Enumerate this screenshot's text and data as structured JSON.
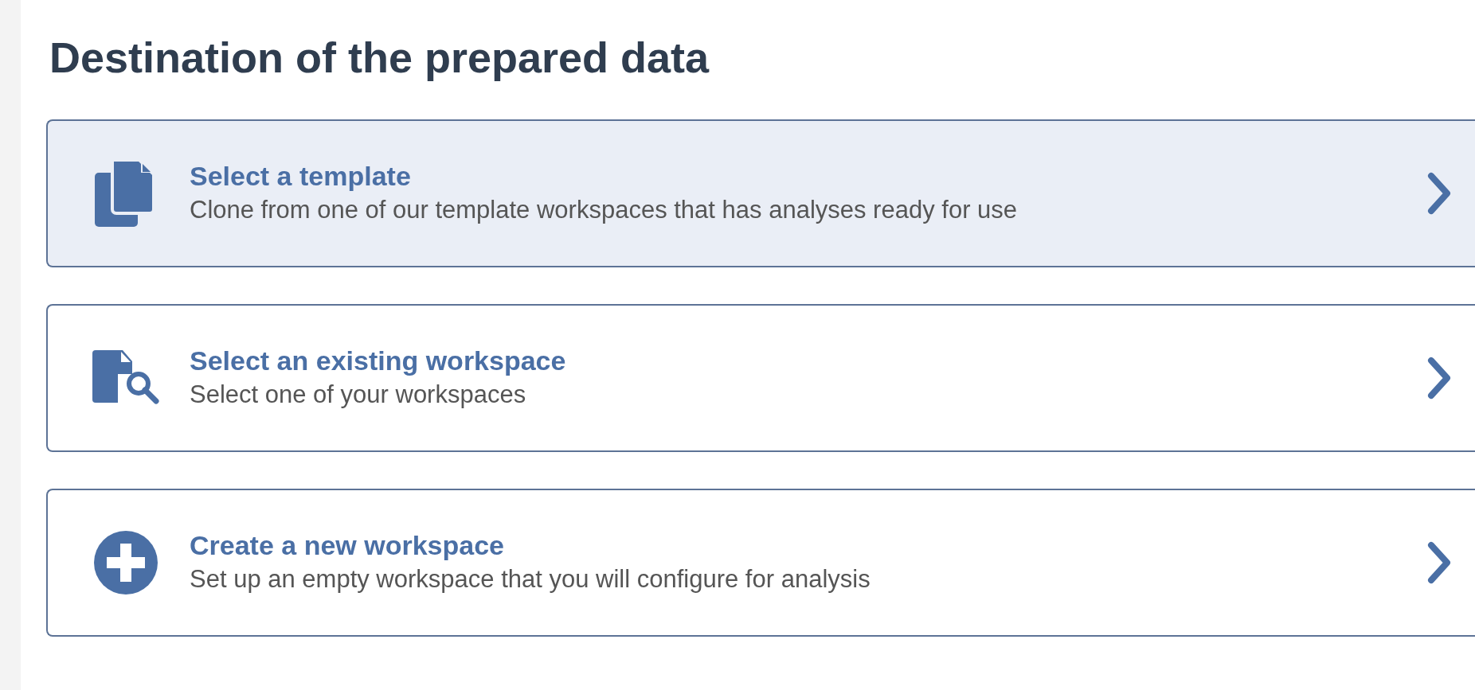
{
  "heading": "Destination of the prepared data",
  "options": [
    {
      "kind": "template",
      "title": "Select a template",
      "description": "Clone from one of our template workspaces that has analyses ready for use",
      "selected": true
    },
    {
      "kind": "existing",
      "title": "Select an existing workspace",
      "description": "Select one of your workspaces",
      "selected": false
    },
    {
      "kind": "new",
      "title": "Create a new workspace",
      "description": "Set up an empty workspace that you will configure for analysis",
      "selected": false
    }
  ]
}
